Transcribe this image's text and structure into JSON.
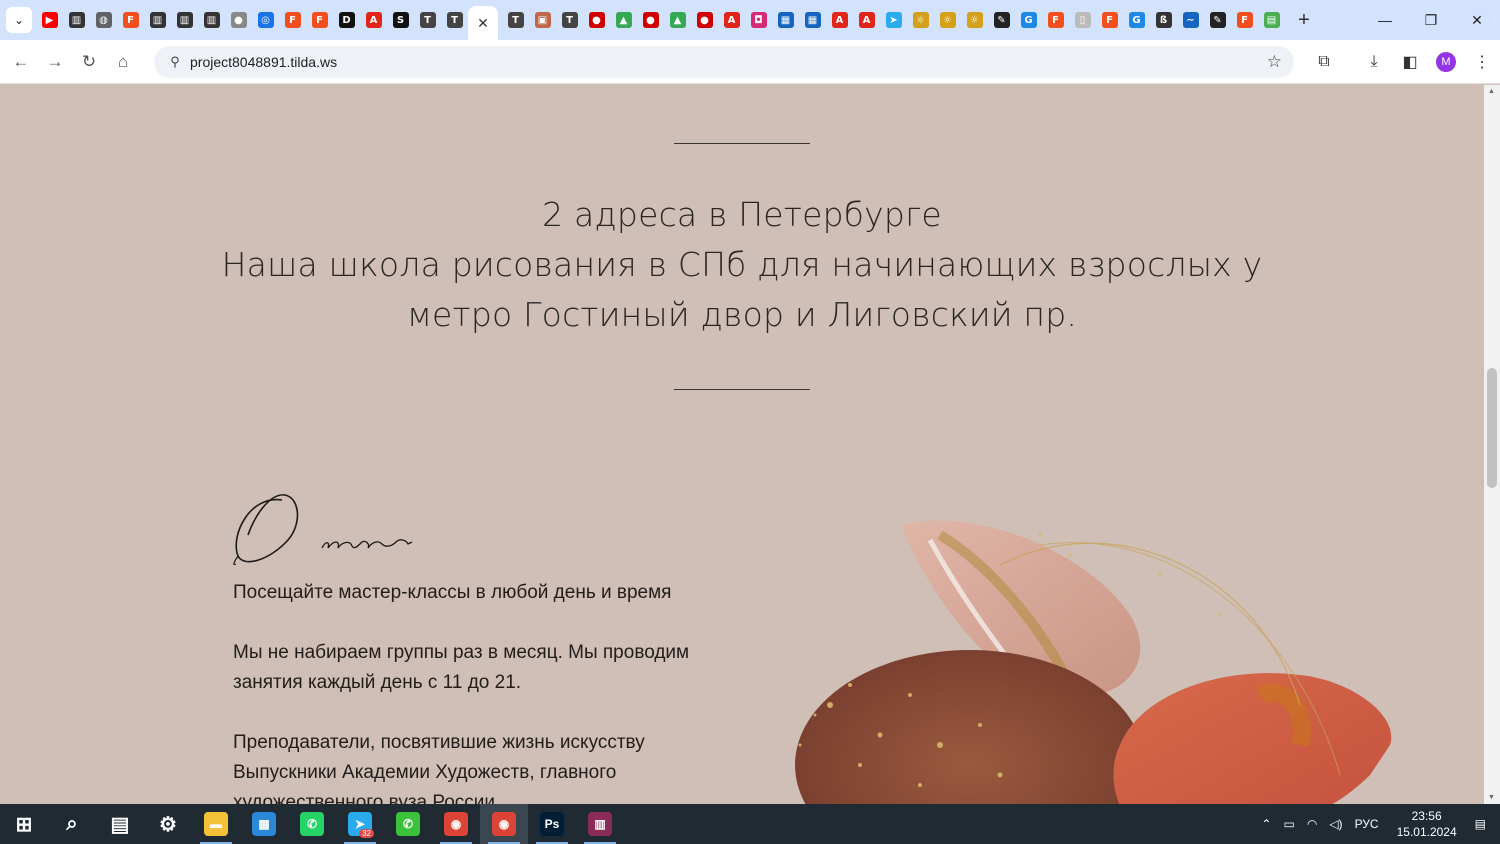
{
  "browser": {
    "url": "project8048891.tilda.ws",
    "profile_initial": "M",
    "tab_favicons": [
      {
        "icon": "youtube-icon",
        "color": "#ff0000",
        "glyph": "▶"
      },
      {
        "icon": "building-icon",
        "color": "#333333",
        "glyph": "▥"
      },
      {
        "icon": "globe-icon",
        "color": "#5f6368",
        "glyph": "◍"
      },
      {
        "icon": "figma-icon",
        "color": "#f24e1e",
        "glyph": "F"
      },
      {
        "icon": "building-icon",
        "color": "#333333",
        "glyph": "▥"
      },
      {
        "icon": "building-icon",
        "color": "#333333",
        "glyph": "▥"
      },
      {
        "icon": "building-icon",
        "color": "#333333",
        "glyph": "▥"
      },
      {
        "icon": "apple-icon",
        "color": "#888888",
        "glyph": "●"
      },
      {
        "icon": "target-icon",
        "color": "#1a73e8",
        "glyph": "◎"
      },
      {
        "icon": "figma-icon",
        "color": "#f24e1e",
        "glyph": "F"
      },
      {
        "icon": "figma-icon",
        "color": "#f24e1e",
        "glyph": "F"
      },
      {
        "icon": "d-icon",
        "color": "#111111",
        "glyph": "D"
      },
      {
        "icon": "adobe-icon",
        "color": "#e1251b",
        "glyph": "A"
      },
      {
        "icon": "st-icon",
        "color": "#111111",
        "glyph": "S"
      },
      {
        "icon": "tilda-icon",
        "color": "#444444",
        "glyph": "T"
      },
      {
        "icon": "tilda-icon",
        "color": "#444444",
        "glyph": "T"
      }
    ],
    "tab_favicons_after": [
      {
        "icon": "tilda-icon",
        "color": "#444444",
        "glyph": "T"
      },
      {
        "icon": "image-icon",
        "color": "#c0664a",
        "glyph": "▣"
      },
      {
        "icon": "tilda-icon",
        "color": "#444444",
        "glyph": "T"
      },
      {
        "icon": "record-icon",
        "color": "#d00000",
        "glyph": "●"
      },
      {
        "icon": "drive-icon",
        "color": "#34a853",
        "glyph": "▲"
      },
      {
        "icon": "record-icon",
        "color": "#d00000",
        "glyph": "●"
      },
      {
        "icon": "drive-icon",
        "color": "#34a853",
        "glyph": "▲"
      },
      {
        "icon": "record-icon",
        "color": "#d00000",
        "glyph": "●"
      },
      {
        "icon": "adobe-icon",
        "color": "#e1251b",
        "glyph": "A"
      },
      {
        "icon": "instagram-icon",
        "color": "#d62976",
        "glyph": "◘"
      },
      {
        "icon": "grid-icon",
        "color": "#1565c0",
        "glyph": "▦"
      },
      {
        "icon": "grid-icon",
        "color": "#1565c0",
        "glyph": "▦"
      },
      {
        "icon": "adobe-icon",
        "color": "#e1251b",
        "glyph": "A"
      },
      {
        "icon": "adobe-icon",
        "color": "#e1251b",
        "glyph": "A"
      },
      {
        "icon": "telegram-icon",
        "color": "#2aabee",
        "glyph": "➤"
      },
      {
        "icon": "sun-icon",
        "color": "#d4a017",
        "glyph": "☼"
      },
      {
        "icon": "sun-icon",
        "color": "#d4a017",
        "glyph": "☼"
      },
      {
        "icon": "sun-icon",
        "color": "#d4a017",
        "glyph": "☼"
      },
      {
        "icon": "pen-icon",
        "color": "#222222",
        "glyph": "✎"
      },
      {
        "icon": "g-icon",
        "color": "#1e88e5",
        "glyph": "G"
      },
      {
        "icon": "figma-icon",
        "color": "#f24e1e",
        "glyph": "F"
      },
      {
        "icon": "doc-icon",
        "color": "#bbbbbb",
        "glyph": "▯"
      },
      {
        "icon": "figma-icon",
        "color": "#f24e1e",
        "glyph": "F"
      },
      {
        "icon": "g-icon",
        "color": "#1e88e5",
        "glyph": "G"
      },
      {
        "icon": "script-icon",
        "color": "#333333",
        "glyph": "ß"
      },
      {
        "icon": "wave-icon",
        "color": "#1565c0",
        "glyph": "∼"
      },
      {
        "icon": "pen-icon",
        "color": "#222222",
        "glyph": "✎"
      },
      {
        "icon": "figma-icon",
        "color": "#f24e1e",
        "glyph": "F"
      },
      {
        "icon": "sheet-icon",
        "color": "#4caf50",
        "glyph": "▤"
      }
    ]
  },
  "page": {
    "headline_line1": "2 адреса в Петербурге",
    "headline_line2": "Наша школа рисования в СПб для начинающих взрослых у",
    "headline_line3": "метро Гостиный двор и Лиговский пр.",
    "about_script_title": "О нас",
    "about_p1": "Посещайте мастер-классы в любой день и время",
    "about_p2": "Мы не набираем группы раз в месяц. Мы проводим занятия каждый день с 11 до 21.",
    "about_p3": "Преподаватели, посвятившие жизнь искусству Выпускники Академии Художеств, главного художественного вуза России",
    "background_color": "#cfbfb6"
  },
  "taskbar": {
    "apps": [
      {
        "name": "windows-start-icon",
        "color": "transparent",
        "glyph": "⊞"
      },
      {
        "name": "search-icon",
        "color": "transparent",
        "glyph": "⌕"
      },
      {
        "name": "task-view-icon",
        "color": "transparent",
        "glyph": "▤"
      },
      {
        "name": "settings-icon",
        "color": "transparent",
        "glyph": "⚙"
      },
      {
        "name": "file-explorer-icon",
        "color": "#f3c13a",
        "glyph": "▬"
      },
      {
        "name": "store-icon",
        "color": "#2b88d8",
        "glyph": "▦"
      },
      {
        "name": "whatsapp-icon",
        "color": "#25d366",
        "glyph": "✆"
      },
      {
        "name": "telegram-icon",
        "color": "#2aabee",
        "glyph": "➤"
      },
      {
        "name": "phone-app-icon",
        "color": "#3cc13b",
        "glyph": "✆"
      },
      {
        "name": "chrome-icon",
        "color": "#db4437",
        "glyph": "◉"
      },
      {
        "name": "chrome-profile-icon",
        "color": "#db4437",
        "glyph": "◉"
      },
      {
        "name": "photoshop-icon",
        "color": "#001e36",
        "glyph": "Ps"
      },
      {
        "name": "winrar-icon",
        "color": "#8b2b5a",
        "glyph": "▥"
      }
    ],
    "telegram_badge": "32",
    "language": "РУС",
    "time": "23:56",
    "date": "15.01.2024"
  }
}
